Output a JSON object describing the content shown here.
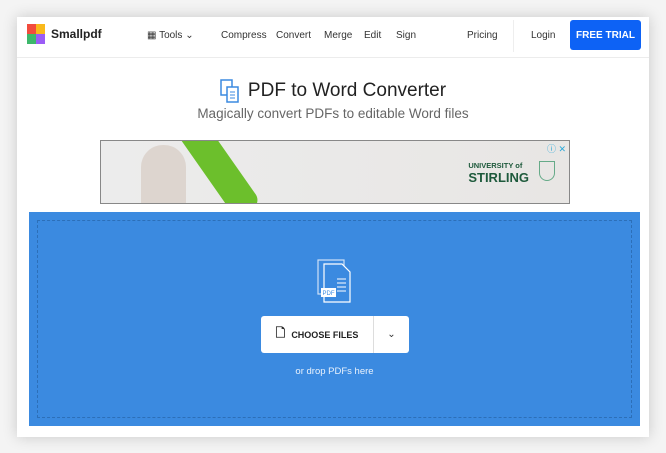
{
  "header": {
    "brand": "Smallpdf",
    "tools": "Tools",
    "nav": [
      "Compress",
      "Convert",
      "Merge",
      "Edit",
      "Sign"
    ],
    "pricing": "Pricing",
    "login": "Login",
    "free_trial": "FREE TRIAL"
  },
  "main": {
    "title": "PDF to Word Converter",
    "subtitle": "Magically convert PDFs to editable Word files"
  },
  "ad": {
    "brand_line1": "UNIVERSITY of",
    "brand_line2": "STIRLING"
  },
  "upload": {
    "choose": "CHOOSE FILES",
    "drop": "or drop PDFs here",
    "badge": "PDF"
  },
  "colors": {
    "accent": "#0d62f5",
    "dropzone": "#3b8ae0"
  }
}
